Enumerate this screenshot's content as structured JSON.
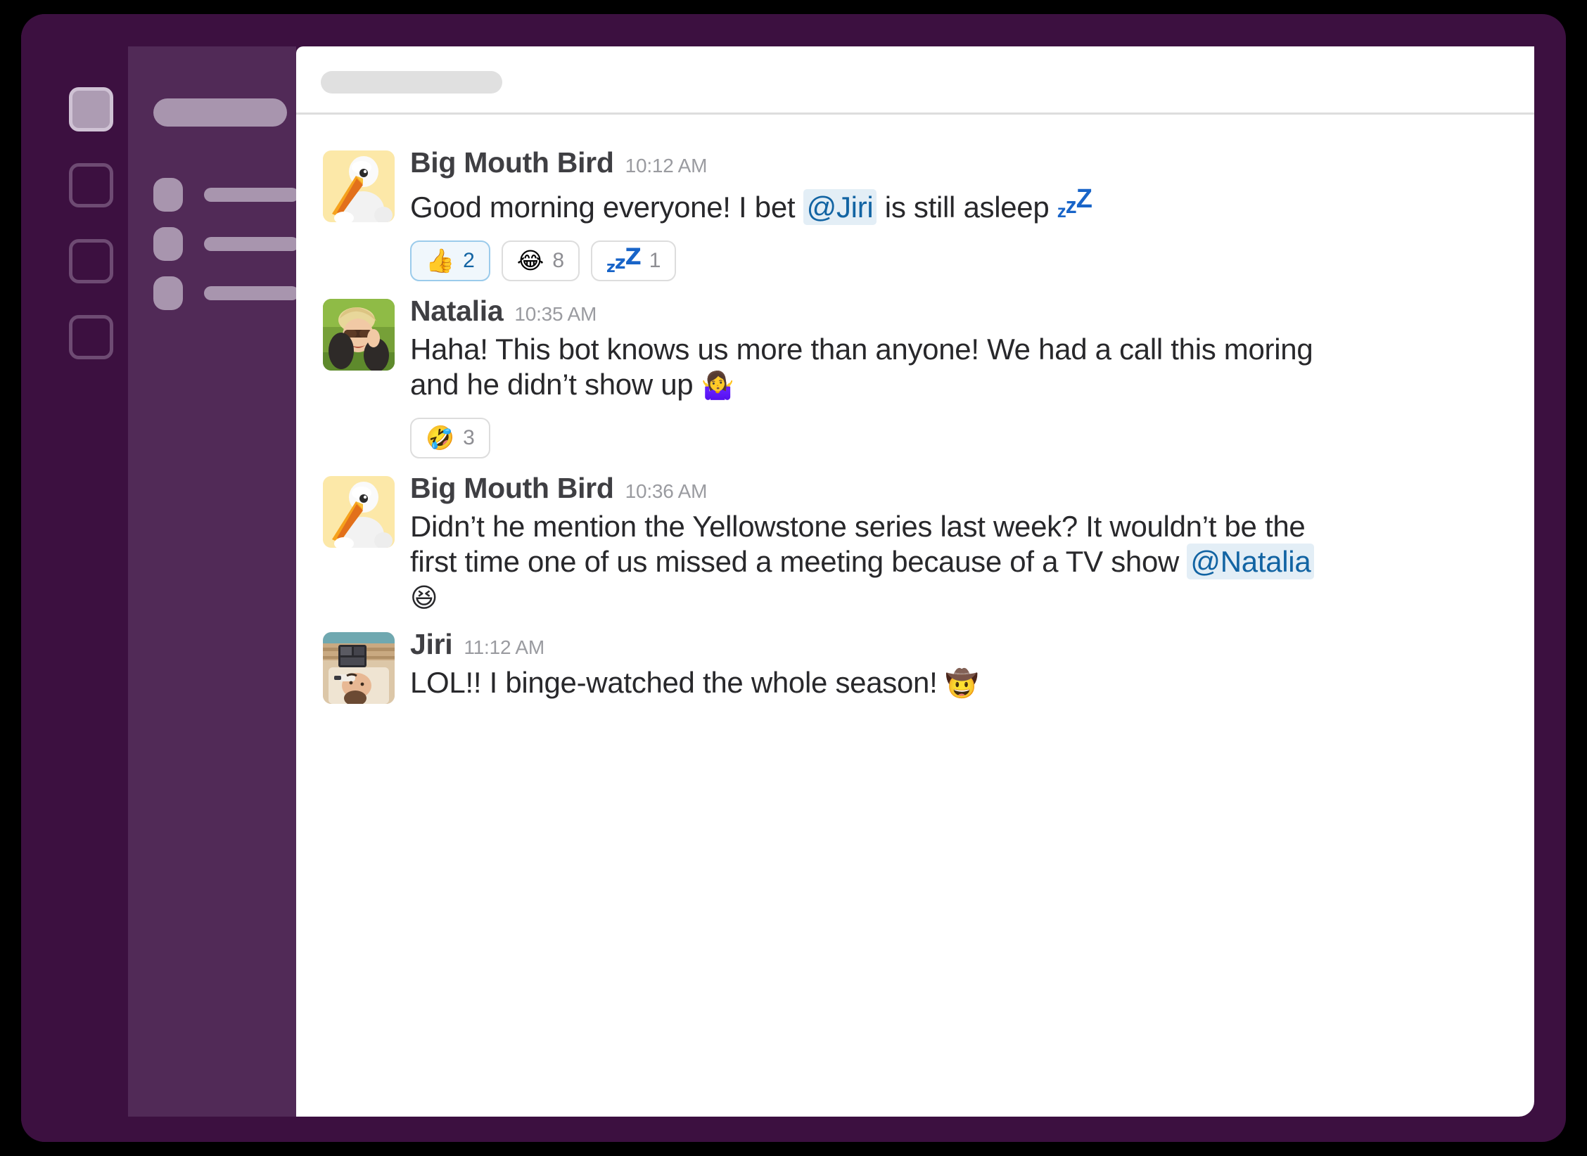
{
  "window": {
    "frame_color": "#3C1040",
    "rail_color": "#3C1040",
    "sidebar_color": "#512A57",
    "panel_color": "#FFFFFF"
  },
  "rail": {
    "tiles": [
      {
        "name": "workspace-tile-active",
        "active": true
      },
      {
        "name": "workspace-tile-2",
        "active": false
      },
      {
        "name": "workspace-tile-3",
        "active": false
      },
      {
        "name": "workspace-tile-4",
        "active": false
      }
    ]
  },
  "sidebar": {
    "items": [
      {
        "label": ""
      },
      {
        "label": ""
      },
      {
        "label": ""
      }
    ]
  },
  "header": {
    "title": ""
  },
  "messages": [
    {
      "author": "Big Mouth Bird",
      "time": "10:12 AM",
      "avatar": "pelican-avatar",
      "text_before": "Good morning everyone! I bet ",
      "mention": "@Jiri",
      "text_after": " is still asleep ",
      "trailing_emoji": "zzz",
      "reactions": [
        {
          "emoji": "👍",
          "name": "thumbs-up",
          "count": "2",
          "reacted": true
        },
        {
          "emoji": "😂",
          "name": "joy",
          "count": "8",
          "reacted": false
        },
        {
          "emoji": "zzz",
          "name": "zzz",
          "count": "1",
          "reacted": false
        }
      ]
    },
    {
      "author": "Natalia",
      "time": "10:35 AM",
      "avatar": "natalia-avatar",
      "text_before": "Haha! This bot knows us more than anyone! We had a call this moring and he didn’t show up ",
      "mention": "",
      "text_after": "",
      "trailing_emoji": "🤷‍♀️",
      "reactions": [
        {
          "emoji": "🤣",
          "name": "rofl",
          "count": "3",
          "reacted": false
        }
      ]
    },
    {
      "author": "Big Mouth Bird",
      "time": "10:36 AM",
      "avatar": "pelican-avatar",
      "text_before": "Didn’t he mention the Yellowstone series last week? It wouldn’t be the first time one of us missed a meeting because of a TV show ",
      "mention": "@Natalia",
      "text_after": " ",
      "trailing_emoji": "😆",
      "reactions": []
    },
    {
      "author": "Jiri",
      "time": "11:12 AM",
      "avatar": "jiri-avatar",
      "text_before": "LOL!! I binge-watched the whole season! ",
      "mention": "",
      "text_after": "",
      "trailing_emoji": "🤠",
      "reactions": []
    }
  ],
  "colors": {
    "mention_bg": "#E3EEF6",
    "mention_text": "#1264A3",
    "reaction_reacted_border": "#9BCBEB",
    "reaction_reacted_bg": "#F0F7FC",
    "author_text": "#3F3F43",
    "time_text": "#9A9BA0",
    "message_text": "#28282B"
  }
}
